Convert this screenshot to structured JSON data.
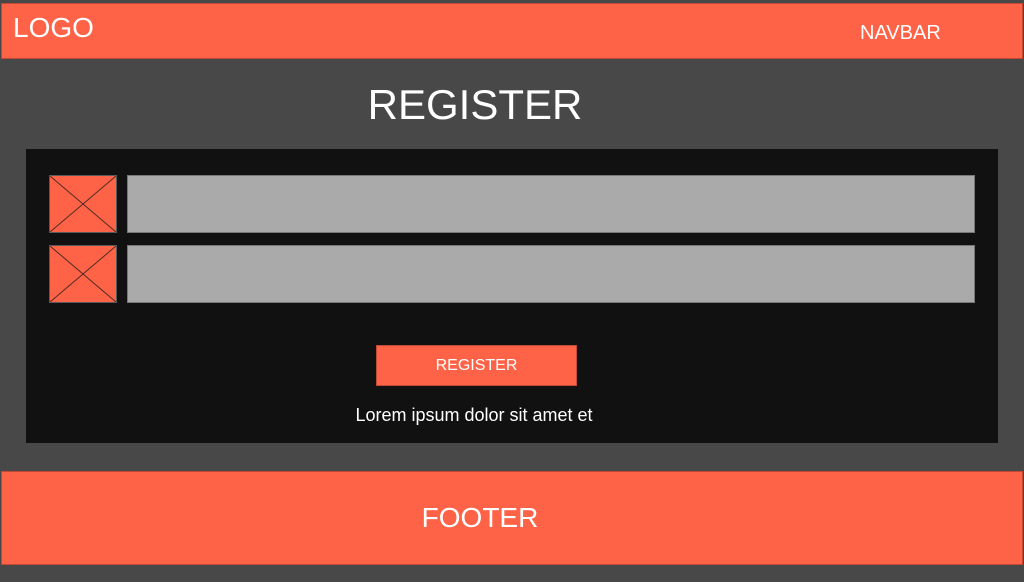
{
  "header": {
    "logo_text": "LOGO",
    "navbar_label": "NAVBAR"
  },
  "main": {
    "title": "REGISTER",
    "fields": [
      {
        "icon": "image-placeholder-icon",
        "value": "",
        "placeholder": ""
      },
      {
        "icon": "image-placeholder-icon",
        "value": "",
        "placeholder": ""
      }
    ],
    "register_button_label": "REGISTER",
    "caption": "Lorem ipsum dolor sit amet et"
  },
  "footer": {
    "text": "FOOTER"
  },
  "colors": {
    "accent": "#ff6347",
    "background": "#484848",
    "panel": "#111111",
    "input": "#aaaaaa"
  }
}
